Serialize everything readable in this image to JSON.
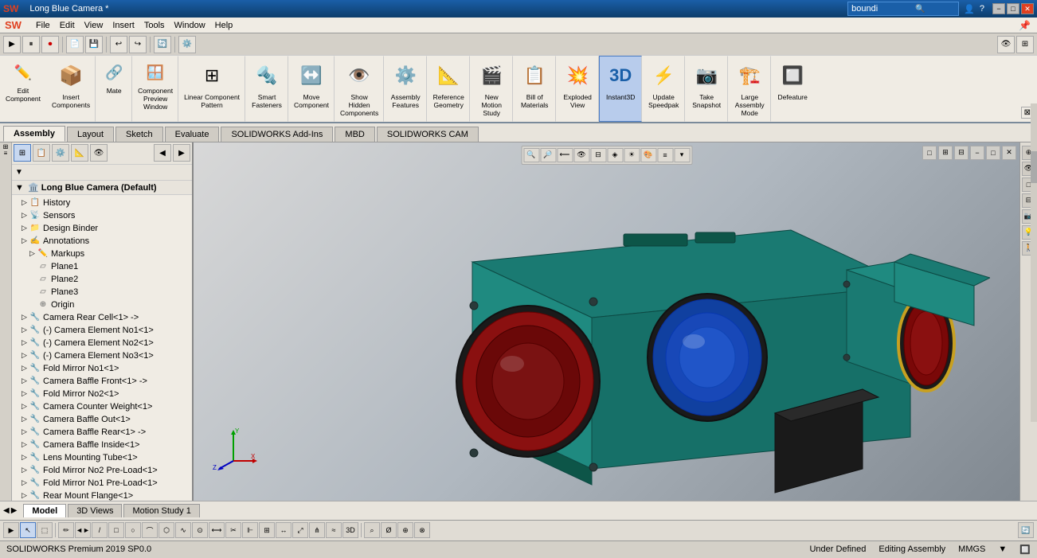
{
  "app": {
    "name": "SOLIDWORKS",
    "version": "SOLIDWORKS Premium 2019 SP0.0",
    "title": "Long Blue Camera *",
    "logo": "SW"
  },
  "titlebar": {
    "title": "Long Blue Camera *",
    "search_placeholder": "boundi",
    "controls": [
      "−",
      "□",
      "✕"
    ],
    "window_controls": [
      "−",
      "□",
      "✕"
    ]
  },
  "menubar": {
    "items": [
      "File",
      "Edit",
      "View",
      "Insert",
      "Tools",
      "Window",
      "Help"
    ]
  },
  "toolbar1": {
    "buttons": [
      "▶",
      "⏸",
      "⏺",
      "📄",
      "💾"
    ]
  },
  "ribbon": {
    "tabs": [
      "Assembly",
      "Layout",
      "Sketch",
      "Evaluate",
      "SOLIDWORKS Add-Ins",
      "MBD",
      "SOLIDWORKS CAM"
    ],
    "active_tab": "Assembly",
    "groups": [
      {
        "name": "edit-component-group",
        "items": [
          {
            "name": "edit-component",
            "label": "Edit\nComponent",
            "icon": "✏️"
          },
          {
            "name": "insert-components",
            "label": "Insert\nComponents",
            "icon": "📦"
          },
          {
            "name": "mate",
            "label": "Mate",
            "icon": "🔗"
          },
          {
            "name": "component-preview-window",
            "label": "Component\nPreview\nWindow",
            "icon": "🪟"
          }
        ]
      },
      {
        "name": "pattern-group",
        "items": [
          {
            "name": "linear-component-pattern",
            "label": "Linear Component\nPattern",
            "icon": "⊞"
          }
        ]
      },
      {
        "name": "smart-fasteners-group",
        "items": [
          {
            "name": "smart-fasteners",
            "label": "Smart\nFasteners",
            "icon": "🔩"
          }
        ]
      },
      {
        "name": "move-group",
        "items": [
          {
            "name": "move-component",
            "label": "Move\nComponent",
            "icon": "↔️"
          }
        ]
      },
      {
        "name": "show-group",
        "items": [
          {
            "name": "show-hidden-components",
            "label": "Show\nHidden\nComponents",
            "icon": "👁️"
          }
        ]
      },
      {
        "name": "assembly-features-group",
        "items": [
          {
            "name": "assembly-features",
            "label": "Assembly\nFeatures",
            "icon": "⚙️"
          }
        ]
      },
      {
        "name": "reference-geometry-group",
        "items": [
          {
            "name": "reference-geometry",
            "label": "Reference\nGeometry",
            "icon": "📐"
          }
        ]
      },
      {
        "name": "new-motion-study-group",
        "items": [
          {
            "name": "new-motion-study",
            "label": "New\nMotion\nStudy",
            "icon": "🎬"
          }
        ]
      },
      {
        "name": "bill-of-materials-group",
        "items": [
          {
            "name": "bill-of-materials",
            "label": "Bill of\nMaterials",
            "icon": "📋"
          }
        ]
      },
      {
        "name": "exploded-view-group",
        "items": [
          {
            "name": "exploded-view",
            "label": "Exploded\nView",
            "icon": "💥"
          }
        ]
      },
      {
        "name": "instant3d-group",
        "items": [
          {
            "name": "instant3d",
            "label": "Instant3D",
            "icon": "3️⃣",
            "active": true
          }
        ]
      },
      {
        "name": "update-speedpak-group",
        "items": [
          {
            "name": "update-speedpak",
            "label": "Update\nSpeedpak",
            "icon": "⚡"
          }
        ]
      },
      {
        "name": "take-snapshot-group",
        "items": [
          {
            "name": "take-snapshot",
            "label": "Take\nSnapshot",
            "icon": "📷"
          }
        ]
      },
      {
        "name": "large-assembly-mode-group",
        "items": [
          {
            "name": "large-assembly-mode",
            "label": "Large\nAssembly\nMode",
            "icon": "🏗️"
          }
        ]
      },
      {
        "name": "defeature-group",
        "items": [
          {
            "name": "defeature",
            "label": "Defeature",
            "icon": "🔲"
          }
        ]
      }
    ]
  },
  "left_panel": {
    "filter_icon": "▼",
    "title": "Long Blue Camera  (Default)",
    "tree": [
      {
        "id": "history",
        "label": "History",
        "icon": "📋",
        "indent": 1,
        "expand": "▷"
      },
      {
        "id": "sensors",
        "label": "Sensors",
        "icon": "📡",
        "indent": 1,
        "expand": "▷"
      },
      {
        "id": "design-binder",
        "label": "Design Binder",
        "icon": "📁",
        "indent": 1,
        "expand": "▷"
      },
      {
        "id": "annotations",
        "label": "Annotations",
        "icon": "✍️",
        "indent": 1,
        "expand": "▷"
      },
      {
        "id": "markups",
        "label": "Markups",
        "icon": "✏️",
        "indent": 2,
        "expand": "▷"
      },
      {
        "id": "plane1",
        "label": "Plane1",
        "icon": "▱",
        "indent": 2,
        "expand": ""
      },
      {
        "id": "plane2",
        "label": "Plane2",
        "icon": "▱",
        "indent": 2,
        "expand": ""
      },
      {
        "id": "plane3",
        "label": "Plane3",
        "icon": "▱",
        "indent": 2,
        "expand": ""
      },
      {
        "id": "origin",
        "label": "Origin",
        "icon": "⊕",
        "indent": 2,
        "expand": ""
      },
      {
        "id": "camera-rear-cell",
        "label": "Camera Rear Cell<1> ->",
        "icon": "🔧",
        "indent": 1,
        "expand": "▷"
      },
      {
        "id": "camera-element-no1",
        "label": "(-) Camera Element No1<1>",
        "icon": "🔧",
        "indent": 1,
        "expand": "▷"
      },
      {
        "id": "camera-element-no2",
        "label": "(-) Camera Element No2<1>",
        "icon": "🔧",
        "indent": 1,
        "expand": "▷"
      },
      {
        "id": "camera-element-no3",
        "label": "(-) Camera Element No3<1>",
        "icon": "🔧",
        "indent": 1,
        "expand": "▷"
      },
      {
        "id": "fold-mirror-no1",
        "label": "Fold Mirror No1<1>",
        "icon": "🔧",
        "indent": 1,
        "expand": "▷"
      },
      {
        "id": "camera-baffle-front",
        "label": "Camera Baffle Front<1> ->",
        "icon": "🔧",
        "indent": 1,
        "expand": "▷"
      },
      {
        "id": "fold-mirror-no2",
        "label": "Fold Mirror No2<1>",
        "icon": "🔧",
        "indent": 1,
        "expand": "▷"
      },
      {
        "id": "camera-counter-weight",
        "label": "Camera Counter Weight<1>",
        "icon": "🔧",
        "indent": 1,
        "expand": "▷"
      },
      {
        "id": "camera-baffle-out",
        "label": "Camera Baffle Out<1>",
        "icon": "🔧",
        "indent": 1,
        "expand": "▷"
      },
      {
        "id": "camera-baffle-rear",
        "label": "Camera Baffle Rear<1> ->",
        "icon": "🔧",
        "indent": 1,
        "expand": "▷"
      },
      {
        "id": "camera-baffle-inside",
        "label": "Camera Baffle Inside<1>",
        "icon": "🔧",
        "indent": 1,
        "expand": "▷"
      },
      {
        "id": "lens-mounting-tube",
        "label": "Lens Mounting Tube<1>",
        "icon": "🔧",
        "indent": 1,
        "expand": "▷"
      },
      {
        "id": "fold-mirror-no2-preload",
        "label": "Fold Mirror No2 Pre-Load<1>",
        "icon": "🔧",
        "indent": 1,
        "expand": "▷"
      },
      {
        "id": "fold-mirror-no1-preload",
        "label": "Fold Mirror No1 Pre-Load<1>",
        "icon": "🔧",
        "indent": 1,
        "expand": "▷"
      },
      {
        "id": "rear-mount-flange",
        "label": "Rear Mount Flange<1>",
        "icon": "🔧",
        "indent": 1,
        "expand": "▷"
      }
    ]
  },
  "viewport": {
    "background": "gradient",
    "model_name": "Long Blue Camera"
  },
  "bottom_tabs": {
    "tabs": [
      "Model",
      "3D Views",
      "Motion Study 1"
    ],
    "active": "Model"
  },
  "bottom_toolbar": {
    "buttons": [
      "▶",
      "◀",
      "⏮",
      "⏭",
      "🔍",
      "↩",
      "↔",
      "⏱"
    ]
  },
  "statusbar": {
    "left": "SOLIDWORKS Premium 2019 SP0.0",
    "center": "",
    "status": "Under Defined",
    "context": "Editing Assembly",
    "units": "MMGS",
    "right": "▼"
  },
  "viewport_toolbar": {
    "buttons": [
      "🔍",
      "🔎",
      "👁",
      "📐",
      "📊",
      "🎯",
      "💡",
      "🎨",
      "⚙️",
      "🖼"
    ]
  }
}
